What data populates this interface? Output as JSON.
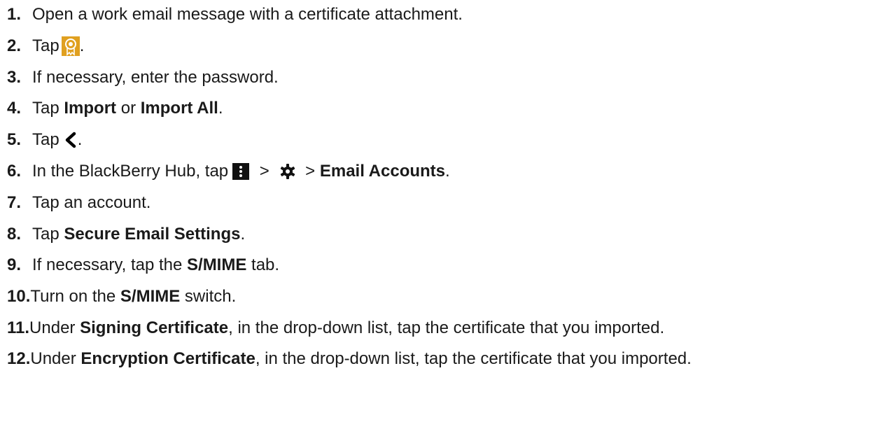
{
  "steps": [
    {
      "num": "1.",
      "text": "Open a work email message with a certificate attachment."
    },
    {
      "num": "2.",
      "pre": "Tap",
      "post": ".",
      "icon": "certificate-icon"
    },
    {
      "num": "3.",
      "text": "If necessary, enter the password."
    },
    {
      "num": "4.",
      "pre": "Tap ",
      "b1": "Import",
      "mid": " or ",
      "b2": "Import All",
      "post": "."
    },
    {
      "num": "5.",
      "pre": "Tap",
      "post": ".",
      "icon": "back-chevron-icon"
    },
    {
      "num": "6.",
      "pre": "In the BlackBerry Hub, tap",
      "sep1": " > ",
      "sep2": " > ",
      "b1": "Email Accounts",
      "post": ".",
      "icons": [
        "overflow-menu-icon",
        "gear-icon"
      ]
    },
    {
      "num": "7.",
      "text": "Tap an account."
    },
    {
      "num": "8.",
      "pre": "Tap ",
      "b1": "Secure Email Settings",
      "post": "."
    },
    {
      "num": "9.",
      "pre": "If necessary, tap the ",
      "b1": "S/MIME",
      "post": " tab."
    },
    {
      "num": "10.",
      "pre": "Turn on the ",
      "b1": "S/MIME",
      "post": " switch."
    },
    {
      "num": "11.",
      "pre": "Under ",
      "b1": "Signing Certificate",
      "post": ", in the drop-down list, tap the certificate that you imported."
    },
    {
      "num": "12.",
      "pre": "Under ",
      "b1": "Encryption Certificate",
      "post": ", in the drop-down list, tap the certificate that you imported."
    }
  ],
  "colors": {
    "text": "#1a1a1a",
    "certificate_icon": "#e0a020"
  }
}
